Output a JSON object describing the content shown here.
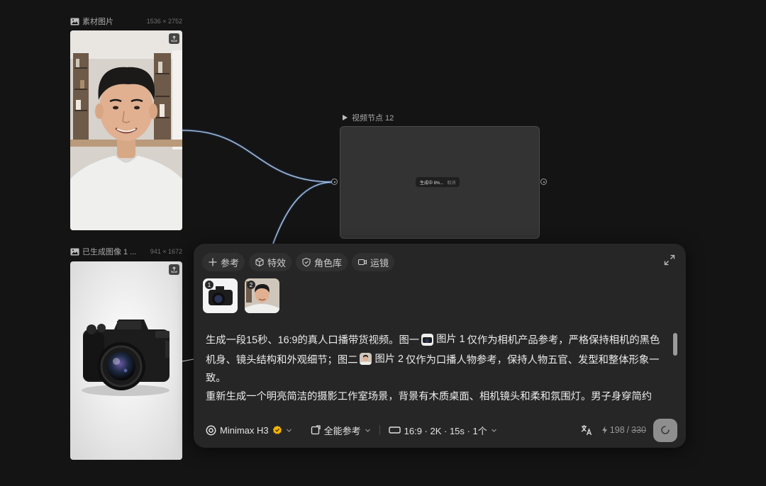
{
  "canvas": {
    "source_node": {
      "title": "素材图片",
      "dims": "1536 × 2752"
    },
    "generated_node": {
      "title": "已生成图像 1 ...",
      "dims": "941 × 1672"
    },
    "video_node": {
      "title": "视频节点 12",
      "progress_text": "生成中 8%...",
      "cancel_label": "取消"
    }
  },
  "prompt_panel": {
    "chips": [
      {
        "icon": "plus-icon",
        "label": "参考"
      },
      {
        "icon": "cube-icon",
        "label": "特效"
      },
      {
        "icon": "shield-icon",
        "label": "角色库"
      },
      {
        "icon": "video-camera-icon",
        "label": "运镜"
      }
    ],
    "references": [
      {
        "number": "1",
        "subject": "camera"
      },
      {
        "number": "2",
        "subject": "person"
      }
    ],
    "prompt": {
      "part1": "生成一段15秒、16:9的真人口播带货视频。图一",
      "ref1_label": "图片 1",
      "part2": "仅作为相机产品参考，严格保持相机的黑色机身、镜头结构和外观细节；图二",
      "ref2_label": "图片 2",
      "part3": "仅作为口播人物参考，保持人物五官、发型和整体形象一致。",
      "paragraph2": "重新生成一个明亮简洁的摄影工作室场景，背景有木质桌面、相机镜头和柔和氛围灯。男子身穿简约"
    },
    "bottom_bar": {
      "model": "Minimax H3",
      "mode": "全能参考",
      "settings": "16:9 · 2K · 15s · 1个",
      "credits_used": "198",
      "credits_sep": "/",
      "credits_total": "330"
    }
  },
  "colors": {
    "background": "#141414",
    "panel": "#262626",
    "wire_glow": "#3d8bff",
    "badge_gold": "#f5b400"
  }
}
